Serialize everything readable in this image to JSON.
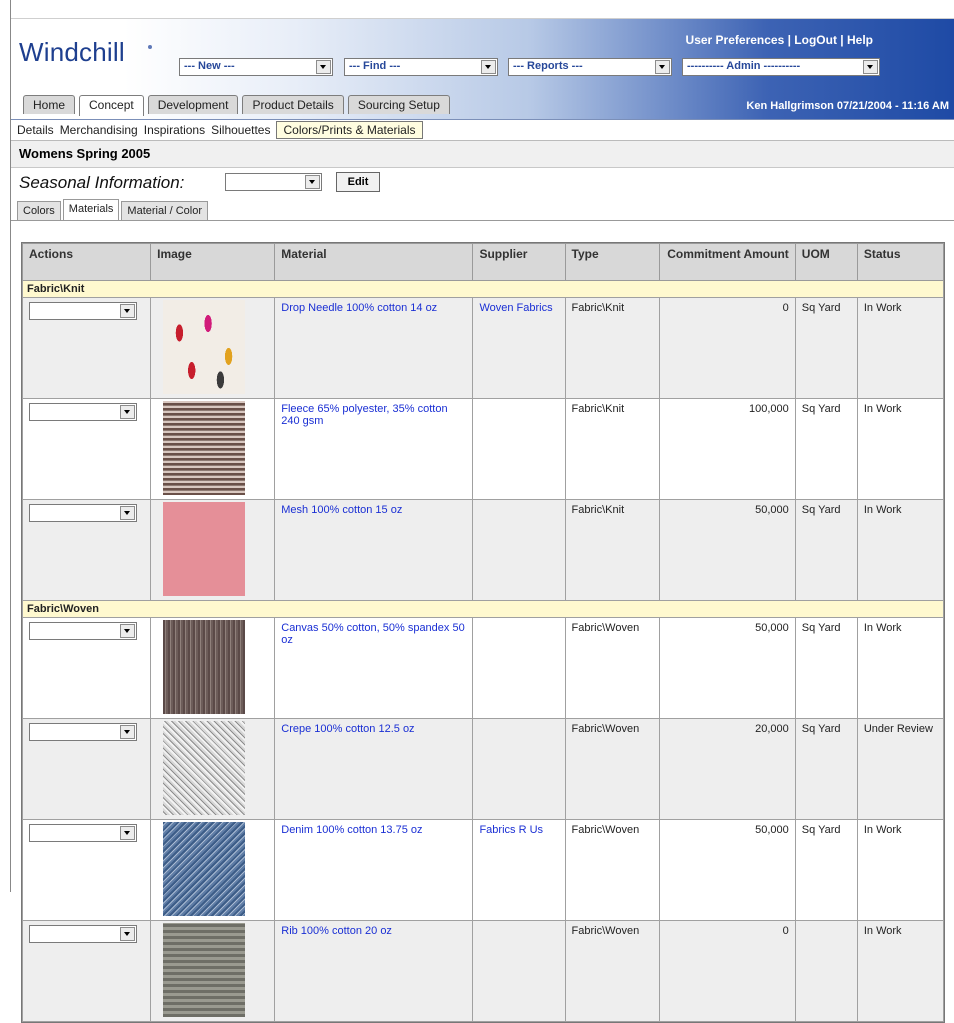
{
  "header": {
    "logo": "Windchill",
    "menus": {
      "new": "--- New ---",
      "find": "--- Find ---",
      "reports": "--- Reports ---",
      "admin": "---------- Admin ----------"
    },
    "toplinks": {
      "preferences": "User Preferences",
      "sep1": " | ",
      "logout": "LogOut",
      "sep2": " | ",
      "help": "Help"
    },
    "user_info": "Ken Hallgrimson   07/21/2004 - 11:16 AM"
  },
  "main_tabs": [
    "Home",
    "Concept",
    "Development",
    "Product Details",
    "Sourcing Setup"
  ],
  "sub_nav": [
    "Details",
    "Merchandising",
    "Inspirations",
    "Silhouettes",
    "Colors/Prints & Materials"
  ],
  "page_title": "Womens Spring 2005",
  "seasonal": {
    "label": "Seasonal Information:",
    "edit_label": "Edit"
  },
  "sub_tabs": [
    "Colors",
    "Materials",
    "Material / Color"
  ],
  "table": {
    "headers": {
      "actions": "Actions",
      "image": "Image",
      "material": "Material",
      "supplier": "Supplier",
      "type": "Type",
      "amount": "Commitment Amount",
      "uom": "UOM",
      "status": "Status"
    },
    "groups": {
      "knit": "Fabric\\Knit",
      "woven": "Fabric\\Woven"
    },
    "rows": [
      {
        "material": "Drop Needle 100% cotton 14 oz",
        "supplier": "Woven Fabrics",
        "type": "Fabric\\Knit",
        "amount": "0",
        "uom": "Sq Yard",
        "status": "In Work"
      },
      {
        "material": "Fleece 65% polyester, 35% cotton 240 gsm",
        "supplier": "",
        "type": "Fabric\\Knit",
        "amount": "100,000",
        "uom": "Sq Yard",
        "status": "In Work"
      },
      {
        "material": "Mesh 100% cotton 15 oz",
        "supplier": "",
        "type": "Fabric\\Knit",
        "amount": "50,000",
        "uom": "Sq Yard",
        "status": "In Work"
      },
      {
        "material": "Canvas 50% cotton, 50% spandex 50 oz",
        "supplier": "",
        "type": "Fabric\\Woven",
        "amount": "50,000",
        "uom": "Sq Yard",
        "status": "In Work"
      },
      {
        "material": "Crepe 100% cotton 12.5 oz",
        "supplier": "",
        "type": "Fabric\\Woven",
        "amount": "20,000",
        "uom": "Sq Yard",
        "status": "Under Review"
      },
      {
        "material": "Denim 100% cotton 13.75 oz",
        "supplier": "Fabrics R Us",
        "type": "Fabric\\Woven",
        "amount": "50,000",
        "uom": "Sq Yard",
        "status": "In Work"
      },
      {
        "material": "Rib 100% cotton 20 oz",
        "supplier": "",
        "type": "Fabric\\Woven",
        "amount": "0",
        "uom": "",
        "status": "In Work"
      }
    ]
  }
}
